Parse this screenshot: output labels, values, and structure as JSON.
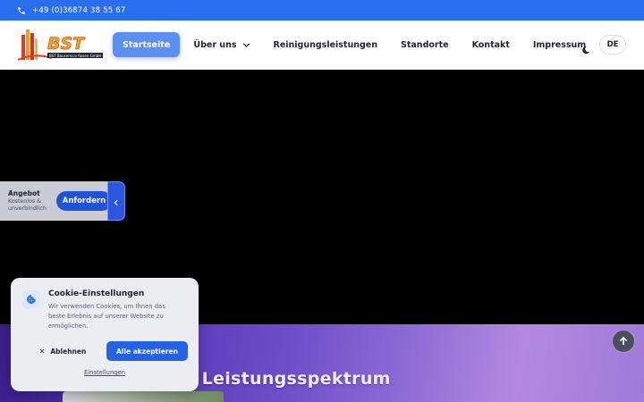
{
  "topbar": {
    "phone": "+49 (0)36874 38 55 67"
  },
  "logo": {
    "brand": "BST",
    "tagline": "BST Bauservice Rosen GmbH"
  },
  "nav": {
    "items": [
      {
        "label": "Startseite",
        "active": true
      },
      {
        "label": "Über uns",
        "dropdown": true
      },
      {
        "label": "Reinigungsleistungen"
      },
      {
        "label": "Standorte"
      },
      {
        "label": "Kontakt"
      },
      {
        "label": "Impressum"
      }
    ],
    "language": "DE"
  },
  "offer": {
    "title": "Angebot",
    "subtitle": "Kostenlos & unverbindlich",
    "button": "Anfordern"
  },
  "section": {
    "title": "Unser breites Leistungsspektrum"
  },
  "cookie": {
    "title": "Cookie-Einstellungen",
    "text": "Wir verwenden Cookies, um Ihnen das beste Erlebnis auf unserer Website zu ermöglichen.",
    "decline": "Ablehnen",
    "accept": "Alle akzeptieren",
    "settings": "Einstellungen"
  },
  "colors": {
    "primary": "#2a6ef0",
    "accent_button": "#2463e6",
    "active_nav": "#5b8ff2"
  }
}
